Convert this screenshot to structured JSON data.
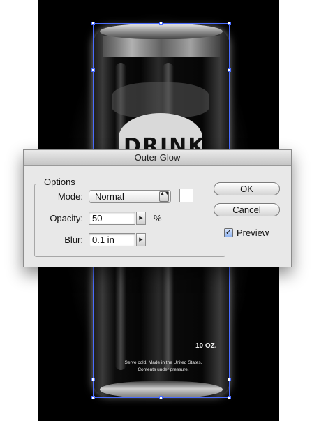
{
  "artwork": {
    "logo_text": "DRINK",
    "size_label": "10 OZ.",
    "fine_print": [
      "Serve cold. Made in the United States.",
      "Contents under pressure."
    ]
  },
  "dialog": {
    "title": "Outer Glow",
    "options_label": "Options",
    "mode": {
      "label": "Mode:",
      "value": "Normal",
      "stepper_glyph": "▲▼"
    },
    "swatch_color": "#ffffff",
    "opacity": {
      "label": "Opacity:",
      "value": "50",
      "unit": "%",
      "arrow_glyph": "▶"
    },
    "blur": {
      "label": "Blur:",
      "value": "0.1 in",
      "arrow_glyph": "▶"
    },
    "ok_label": "OK",
    "cancel_label": "Cancel",
    "preview": {
      "label": "Preview",
      "checked": true,
      "check_glyph": "✓"
    }
  },
  "colors": {
    "selection": "#4a6cff",
    "canvas": "#000000",
    "dialog_bg": "#e8e8e8"
  }
}
